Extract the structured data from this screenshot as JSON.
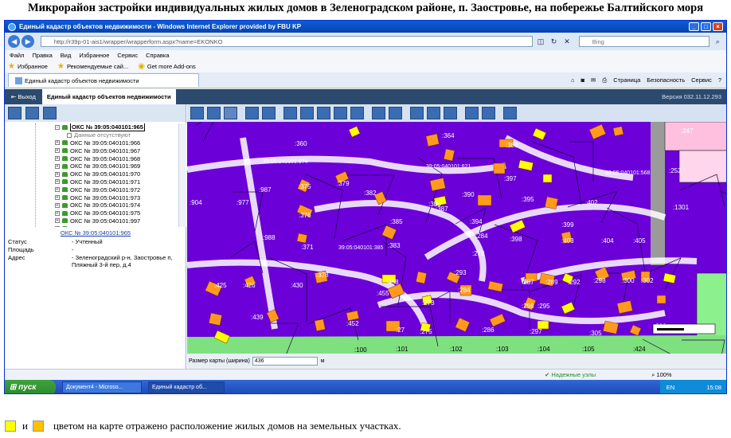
{
  "doc": {
    "title": "Микрорайон застройки индивидуальных жилых домов в Зеленоградском районе, п. Заостровье, на побережье Балтийского моря",
    "legend_and": "и",
    "legend_caption": "цветом на карте отражено расположение жилых домов на земельных участках.",
    "legend_colors": [
      "#ffff00",
      "#ffc000"
    ]
  },
  "browser": {
    "window_title": "Единый кадастр объектов недвижимости - Windows Internet Explorer provided by FBU KP",
    "url": "http://r39p-01-ais1/wrapper/wrapperform.aspx?name=EKONKO",
    "search_placeholder": "Bing",
    "menu": [
      "Файл",
      "Правка",
      "Вид",
      "Избранное",
      "Сервис",
      "Справка"
    ],
    "favorites": [
      "Избранное",
      "Рекомендуемые сай...",
      "Get more Add-ons"
    ],
    "tab_label": "Единый кадастр объектов недвижимости",
    "tab_tools": [
      "Страница",
      "Безопасность",
      "Сервис"
    ],
    "status_zone": "Надежные узлы",
    "zoom": "100%"
  },
  "app": {
    "exit_label": "Выход",
    "tab_label": "Единый кадастр объектов недвижимости",
    "version": "Версия 032.11.12.293",
    "tree": {
      "selected": "ОКС № 39:05:040101:965",
      "no_data": "Данные отсутствуют",
      "items": [
        "ОКС № 39:05:040101:966",
        "ОКС № 39:05:040101:967",
        "ОКС № 39:05:040101:968",
        "ОКС № 39:05:040101:969",
        "ОКС № 39:05:040101:970",
        "ОКС № 39:05:040101:971",
        "ОКС № 39:05:040101:972",
        "ОКС № 39:05:040101:973",
        "ОКС № 39:05:040101:974",
        "ОКС № 39:05:040101:975",
        "ОКС № 39:05:040101:997",
        "ОКС № 39:05:040101:998",
        "ОКС № 39:05:040101:999"
      ]
    },
    "info": {
      "link": "ОКС № 39:05:040101:965",
      "rows": [
        {
          "k": "Статус",
          "v": "- Учтенный"
        },
        {
          "k": "Площадь",
          "v": "-"
        },
        {
          "k": "Адрес",
          "v": "- Зеленоградский р-н, Заостровье п, Пляжный 3-й пер, д.4"
        }
      ]
    },
    "scale_label": "Размер карты (ширина)",
    "scale_value": "436",
    "scale_unit": "м"
  },
  "map": {
    "parcel_labels": [
      ":247",
      ":360",
      ":364",
      ":388",
      ":252",
      ":1301",
      ":987",
      ":375",
      ":379",
      ":382",
      ":386",
      ":390",
      ":397",
      ":904",
      ":977",
      ":376",
      ":385",
      ":387",
      ":394",
      ":395",
      ":402",
      ":399",
      ":988",
      ":371",
      ":383",
      ":284",
      ":278",
      ":398",
      ":403",
      ":404",
      ":405",
      ":430",
      ":426",
      ":378",
      ":458",
      ":293",
      ":287",
      ":289",
      ":292",
      ":298",
      ":300",
      ":302",
      ":455",
      ":273",
      ":284",
      ":295",
      ":298",
      ":439",
      ":452",
      ":27",
      ":275",
      ":286",
      ":297",
      ":305",
      ":306",
      ":99",
      ":100",
      ":101",
      ":102",
      ":103",
      ":104",
      ":105",
      ":424",
      ":425"
    ],
    "cadastral_labels": [
      "39:05:040101:974",
      "39:05:040101:821",
      "39:05:040101:568",
      "39:05:040101:385"
    ]
  },
  "taskbar": {
    "start": "пуск",
    "items": [
      "Документ4 - Microso...",
      "Единый кадастр об..."
    ],
    "lang": "EN",
    "time": "15:08"
  }
}
